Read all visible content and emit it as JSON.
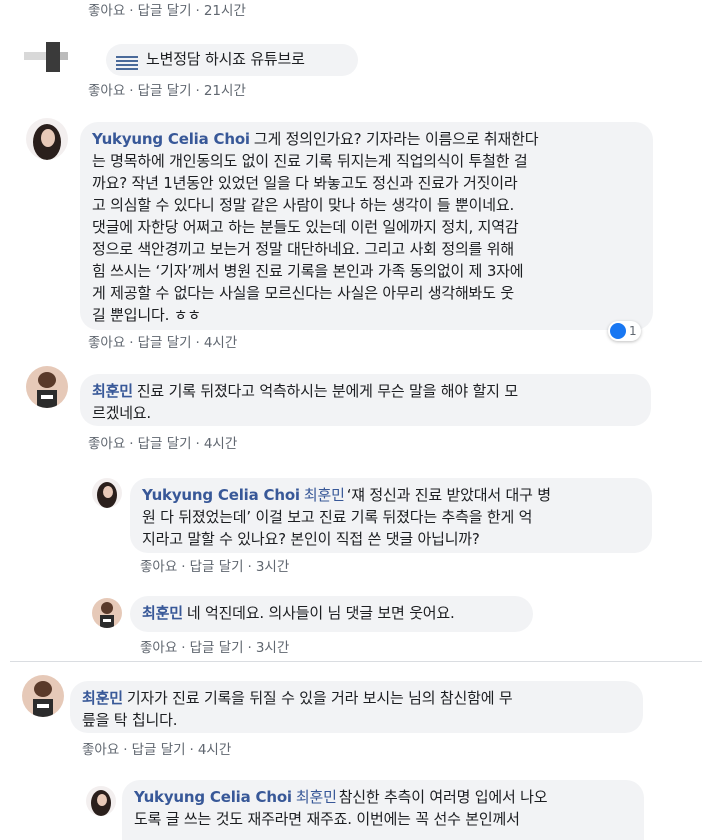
{
  "actions": {
    "like": "좋아요",
    "reply": "답글 달기",
    "sep": "·"
  },
  "comments": [
    {
      "time": "21시간"
    },
    {
      "lines": [
        "노변정담 하시죠 유튜브로"
      ],
      "time": "21시간"
    },
    {
      "author": "Yukyung Celia Choi",
      "lines": [
        "그게 정의인가요? 기자라는 이름으로 취재한다",
        "는 명목하에 개인동의도 없이 진료 기록 뒤지는게 직업의식이 투철한 걸",
        "까요? 작년 1년동안 있었던 일을 다 봐놓고도 정신과 진료가 거짓이라",
        "고 의심할 수 있다니 정말 같은 사람이 맞나 하는 생각이 들 뿐이네요.",
        "댓글에 자한당 어쩌고 하는 분들도 있는데 이런 일에까지 정치, 지역감",
        "정으로 색안경끼고 보는거 정말 대단하네요. 그리고 사회 정의를 위해",
        "힘 쓰시는 ‘기자’께서 병원 진료 기록을 본인과 가족 동의없이 제 3자에",
        "게 제공할 수 없다는 사실을 모르신다는 사실은 아무리 생각해봐도 웃",
        "길 뿐입니다. ㅎㅎ"
      ],
      "reaction_count": "1",
      "time": "4시간"
    },
    {
      "author": "최훈민",
      "lines": [
        "진료 기록 뒤졌다고 억측하시는 분에게 무슨 말을 해야 할지 모",
        "르겠네요."
      ],
      "time": "4시간"
    },
    {
      "author": "Yukyung Celia Choi",
      "tag": "최훈민",
      "lines": [
        "‘쟤 정신과 진료 받았대서 대구 병",
        "원 다 뒤졌었는데’ 이걸 보고 진료 기록 뒤졌다는 추측을 한게 억",
        "지라고 말할 수 있나요? 본인이 직접 쓴 댓글 아닙니까?"
      ],
      "time": "3시간"
    },
    {
      "author": "최훈민",
      "lines": [
        "네 억진데요. 의사들이 님 댓글 보면 웃어요."
      ],
      "time": "3시간"
    },
    {
      "author": "최훈민",
      "lines": [
        "기자가 진료 기록을 뒤질 수 있을 거라 보시는 님의 참신함에 무",
        "릎을 탁 칩니다."
      ],
      "time": "4시간"
    },
    {
      "author": "Yukyung Celia Choi",
      "tag": "최훈민",
      "lines": [
        "참신한 추측이 여러명 입에서 나오",
        "도록 글 쓰는 것도 재주라면 재주죠. 이번에는 꼭 선수 본인께서"
      ]
    }
  ],
  "colors": {
    "name": "#385898",
    "bubble": "#f2f3f5",
    "meta": "#606770",
    "like": "#1877f2"
  }
}
